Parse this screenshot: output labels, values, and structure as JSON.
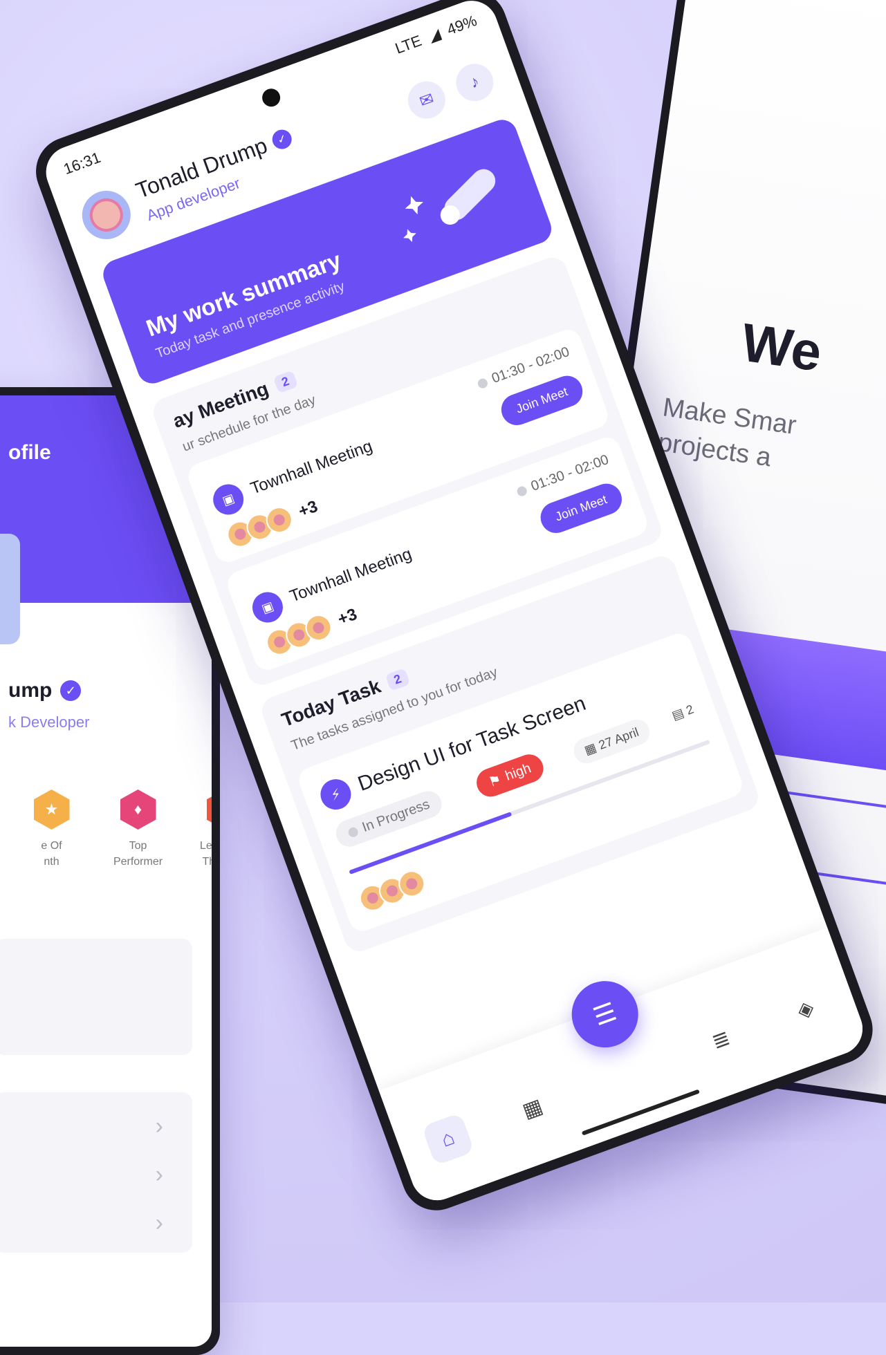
{
  "colors": {
    "accent": "#6c4ef5",
    "danger": "#ef4444",
    "background": "#d9d4fb"
  },
  "left_phone": {
    "header_title": "ofile",
    "name": "ump",
    "role": "k Developer",
    "badges": [
      {
        "label": "e Of\nnth",
        "icon": "medal-icon",
        "color": "#f6b04a"
      },
      {
        "label": "Top\nPerformer",
        "icon": "diamond-icon",
        "color": "#e6457a"
      },
      {
        "label": "Leader Of\nThe Year",
        "icon": "crown-icon",
        "color": "#f0573f"
      }
    ]
  },
  "main_phone": {
    "status": {
      "time": "16:31",
      "network": "LTE",
      "battery": "49%"
    },
    "user": {
      "name": "Tonald Drump",
      "role": "App developer"
    },
    "summary": {
      "title": "My work summary",
      "subtitle": "Today task and presence activity"
    },
    "meetings": {
      "title": "ay Meeting",
      "count": "2",
      "subtitle": "ur schedule for the day",
      "items": [
        {
          "title": "Townhall Meeting",
          "time": "01:30 - 02:00",
          "button": "Join Meet",
          "extra": "+3"
        },
        {
          "title": "Townhall Meeting",
          "time": "01:30 - 02:00",
          "button": "Join Meet",
          "extra": "+3"
        }
      ]
    },
    "tasks": {
      "title": "Today Task",
      "count": "2",
      "subtitle": "The tasks assigned to you for today",
      "item": {
        "title": "Design UI for Task Screen",
        "status": "In Progress",
        "priority": "high",
        "date": "27 April",
        "comments": "2",
        "progress": 0.45
      }
    }
  },
  "right_phone": {
    "title": "We",
    "subtitle": "Make Smar\nprojects a"
  }
}
